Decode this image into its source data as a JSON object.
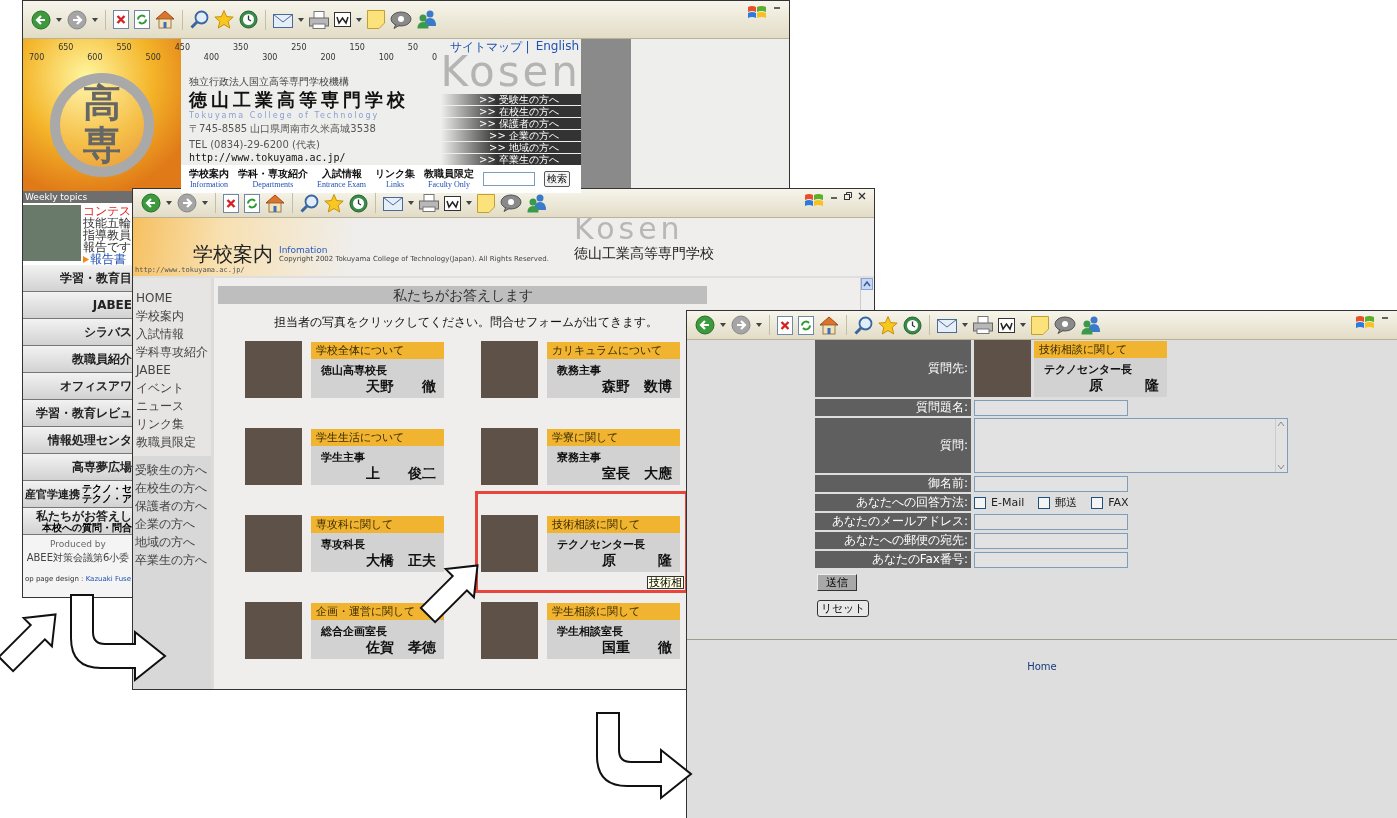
{
  "home_window": {
    "header": {
      "sitemap_link": "サイトマップ |",
      "english_link": "English",
      "ruler_labels": [
        "700",
        "650",
        "600",
        "550",
        "500",
        "450",
        "400",
        "350",
        "300",
        "250",
        "200",
        "150",
        "100",
        "50",
        "0"
      ],
      "watermark": "Kosen",
      "logo_text": "高専",
      "organization": "独立行政法人国立高等専門学校機構",
      "school_name": "徳山工業高等専門学校",
      "school_name_en": "Tokuyama College of Technology",
      "address": "〒745-8585 山口県周南市久米高城3538",
      "phone": "TEL (0834)-29-6200 (代表)",
      "url": "http://www.tokuyama.ac.jp/",
      "audience_links": [
        ">> 受験生の方へ",
        ">> 在校生の方へ",
        ">> 保護者の方へ",
        ">> 企業の方へ",
        ">> 地域の方へ",
        ">> 卒業生の方へ"
      ],
      "nav": [
        {
          "label": "学校案内",
          "sublabel": "Information"
        },
        {
          "label": "学科・専攻紹介",
          "sublabel": "Departments"
        },
        {
          "label": "入試情報",
          "sublabel": "Entrance Exam"
        },
        {
          "label": "リンク集",
          "sublabel": "Links"
        },
        {
          "label": "教職員限定",
          "sublabel": "Faculty Only"
        }
      ],
      "search_button": "検索"
    },
    "weekly_topics": {
      "title": "Weekly topics",
      "headline": "コンテス",
      "lines": [
        "技能五輪",
        "指導教員",
        "報告です"
      ],
      "link": "報告書"
    },
    "menu": [
      {
        "label": "学習・教育目"
      },
      {
        "label": "JABEE"
      },
      {
        "label": "シラバス"
      },
      {
        "label": "教職員紹介"
      },
      {
        "label": "オフィスアワ"
      },
      {
        "label": "学習・教育レビュ"
      },
      {
        "label": "情報処理センタ"
      },
      {
        "label": "高専夢広場"
      },
      {
        "label": "産官学連携",
        "sub": [
          "テクノ・セ",
          "テクノ・ア"
        ]
      },
      {
        "label": "私たちがお答えし",
        "sub": [
          "本校への質問・問合"
        ]
      }
    ],
    "footer": {
      "produced_by": "Produced by",
      "committee": "ABEE対策会議第6小委",
      "design_label": "op page design :",
      "designer": "Kazuaki Fuse"
    }
  },
  "info_window": {
    "header": {
      "title": "学校案内",
      "title_en": "Infomation",
      "copyright": "Copyright 2002 Tokuyama College of Technology(Japan). All Rights Reserved.",
      "school_name": "徳山工業高等専門学校",
      "watermark": "Kosen",
      "url": "http://www.tokuyama.ac.jp/"
    },
    "menu": [
      "HOME",
      "学校案内",
      "入試情報",
      "学科専攻紹介",
      "JABEE",
      "イベント",
      "ニュース",
      "リンク集",
      "教職員限定"
    ],
    "audience_menu": [
      "受験生の方へ",
      "在校生の方へ",
      "保護者の方へ",
      "企業の方へ",
      "地域の方へ",
      "卒業生の方へ"
    ],
    "heading": "私たちがお答えします",
    "instruction": "担当者の写真をクリックしてください。問合せフォームが出てきます。",
    "contacts": [
      {
        "topic": "学校全体について",
        "role": "徳山高専校長",
        "name": "天野　　徹",
        "selected": false
      },
      {
        "topic": "カリキュラムについて",
        "role": "教務主事",
        "name": "森野　数博",
        "selected": false
      },
      {
        "topic": "学生生活について",
        "role": "学生主事",
        "name": "上　　俊二",
        "selected": false
      },
      {
        "topic": "学寮に関して",
        "role": "寮務主事",
        "name": "室長　大應",
        "selected": false
      },
      {
        "topic": "専攻科に関して",
        "role": "専攻科長",
        "name": "大橋　正夫",
        "selected": false
      },
      {
        "topic": "技術相談に関して",
        "role": "テクノセンター長",
        "name": "原　　　隆",
        "selected": true,
        "tooltip": "技術相"
      },
      {
        "topic": "企画・運営に関して",
        "role": "総合企画室長",
        "name": "佐賀　孝徳",
        "selected": false
      },
      {
        "topic": "学生相談に関して",
        "role": "学生相談室長",
        "name": "国重　　徹",
        "selected": false
      }
    ]
  },
  "form_window": {
    "recipient_label": "質問先:",
    "recipient": {
      "topic": "技術相談に関して",
      "role": "テクノセンター長",
      "name": "原　　　隆"
    },
    "fields": [
      {
        "label": "質問題名:",
        "kind": "text"
      },
      {
        "label": "質問:",
        "kind": "textarea"
      },
      {
        "label": "御名前:",
        "kind": "text"
      },
      {
        "label": "あなたへの回答方法:",
        "kind": "checkboxes",
        "options": [
          {
            "label": "E-Mail",
            "checked": false
          },
          {
            "label": "郵送",
            "checked": false
          },
          {
            "label": "FAX",
            "checked": false
          }
        ]
      },
      {
        "label": "あなたのメールアドレス:",
        "kind": "text"
      },
      {
        "label": "あなたへの郵便の宛先:",
        "kind": "text"
      },
      {
        "label": "あなたのFax番号:",
        "kind": "text"
      }
    ],
    "submit_button": "送信",
    "reset_button": "リセット",
    "footer_link": "Home"
  }
}
